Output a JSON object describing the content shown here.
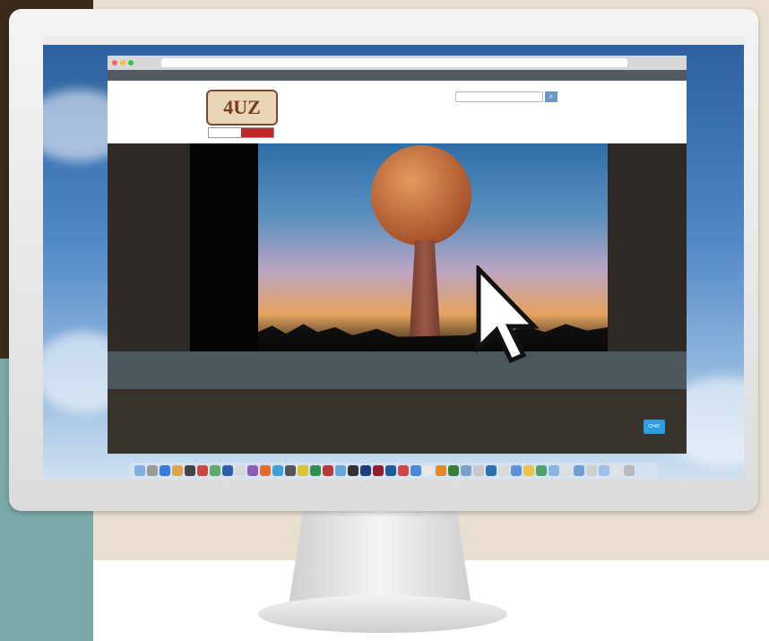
{
  "logo": {
    "text": "4UZ",
    "sub_text": ""
  },
  "browser": {
    "url": ""
  },
  "topnav": {
    "items": []
  },
  "header": {
    "search_placeholder": "",
    "signin": ""
  },
  "side_menu": {
    "items": []
  },
  "footer": {
    "address_lines": [],
    "copyright": "",
    "social": ""
  },
  "chat": {
    "label": "CHAT"
  },
  "colors": {
    "nav_bar": "#505a60",
    "footer": "#4d585e",
    "search_button": "#6d96c9",
    "chat_button": "#2b9de0",
    "logo_red": "#c0282a"
  }
}
